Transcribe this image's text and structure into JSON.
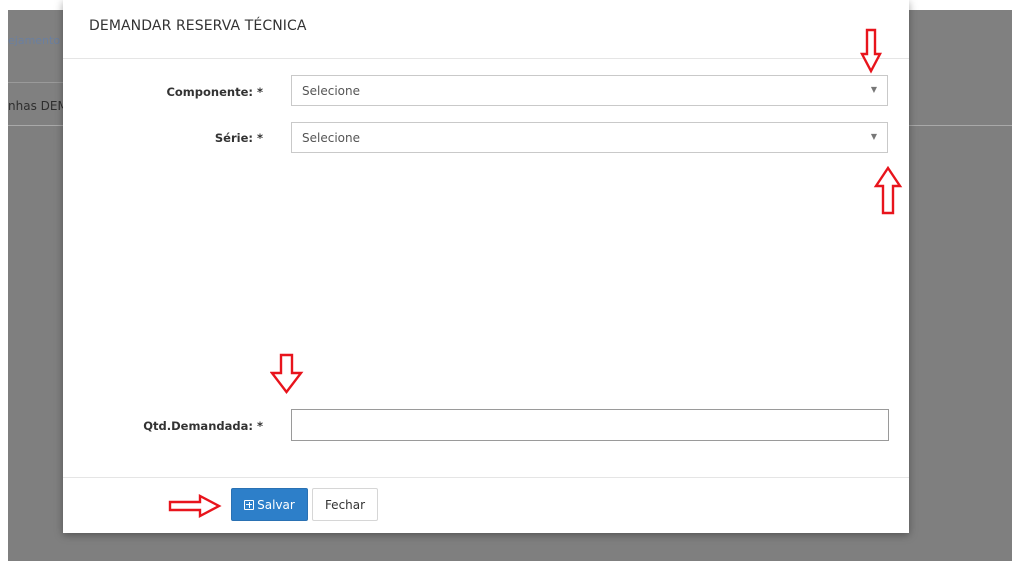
{
  "background": {
    "nav_text": "ejamento",
    "heading_text": "nhas DEM"
  },
  "modal": {
    "title": "DEMANDAR RESERVA TÉCNICA",
    "fields": {
      "componente": {
        "label": "Componente: *",
        "placeholder": "Selecione"
      },
      "serie": {
        "label": "Série: *",
        "placeholder": "Selecione"
      },
      "qtd": {
        "label": "Qtd.Demandada: *",
        "value": ""
      }
    },
    "footer": {
      "save_label": "Salvar",
      "close_label": "Fechar"
    }
  },
  "annotations": {
    "color": "#e8141c",
    "arrows": [
      "arrow-down",
      "arrow-up",
      "arrow-down",
      "arrow-right"
    ]
  },
  "colors": {
    "primary": "#2d7fc9",
    "overlay": "#7f7f7f"
  }
}
